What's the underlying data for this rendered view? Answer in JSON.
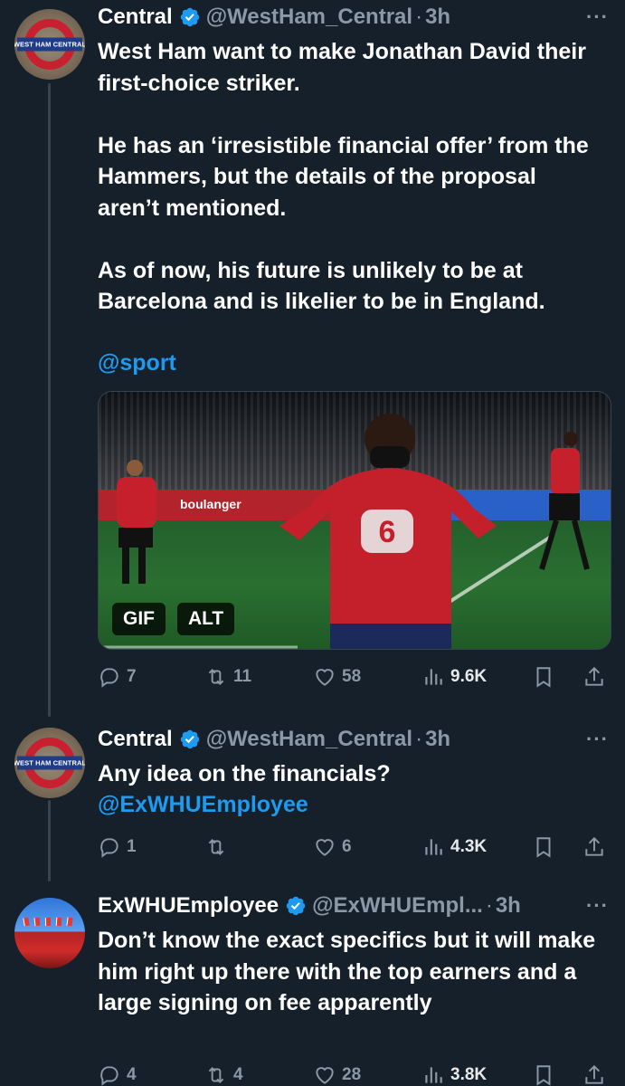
{
  "tweets": [
    {
      "name": "Central",
      "handle": "@WestHam_Central",
      "sep": "·",
      "time": "3h",
      "more": "···",
      "avatar_text": "WEST HAM CENTRAL",
      "body": "West Ham want to make Jonathan David their first-choice striker.\n\nHe has an ‘irresistible financial offer’ from the Hammers, but the details of the proposal aren’t mentioned.\n\nAs of now, his future is unlikely to be at Barcelona and is likelier to be in England.",
      "link": "@sport",
      "media": {
        "badge_gif": "GIF",
        "badge_alt": "ALT",
        "adboard_text": "boulanger"
      },
      "replies": "7",
      "retweets": "11",
      "likes": "58",
      "views": "9.6K"
    },
    {
      "name": "Central",
      "handle": "@WestHam_Central",
      "sep": "·",
      "time": "3h",
      "more": "···",
      "avatar_text": "WEST HAM CENTRAL",
      "body": "Any idea on the financials?",
      "link": "@ExWHUEmployee",
      "replies": "1",
      "retweets": "",
      "likes": "6",
      "views": "4.3K"
    },
    {
      "name": "ExWHUEmployee",
      "handle": "@ExWHUEmpl...",
      "sep": "·",
      "time": "3h",
      "more": "···",
      "body": "Don’t know the exact specifics but it will make him right up there with the top earners and a large signing on fee apparently",
      "replies": "4",
      "retweets": "4",
      "likes": "28",
      "views": "3.8K"
    }
  ],
  "colors": {
    "background": "#15202b",
    "text": "#ffffff",
    "muted": "#8b98a5",
    "link": "#1d9bf0",
    "verified": "#1d9bf0"
  }
}
